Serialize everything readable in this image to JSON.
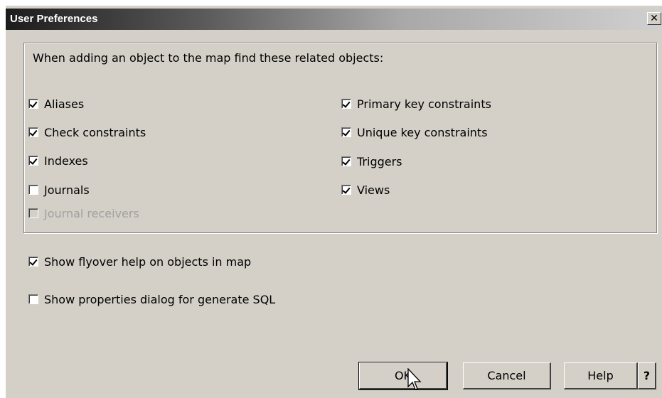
{
  "window": {
    "title": "User Preferences",
    "close_glyph": "✕"
  },
  "group": {
    "label": "When adding an object to the map find these related objects:",
    "left_items": [
      {
        "label": "Aliases",
        "checked": true,
        "enabled": true
      },
      {
        "label": "Check constraints",
        "checked": true,
        "enabled": true
      },
      {
        "label": "Indexes",
        "checked": true,
        "enabled": true
      },
      {
        "label": "Journals",
        "checked": false,
        "enabled": true
      },
      {
        "label": "Journal receivers",
        "checked": false,
        "enabled": false
      }
    ],
    "right_items": [
      {
        "label": "Primary key constraints",
        "checked": true,
        "enabled": true
      },
      {
        "label": "Unique key constraints",
        "checked": true,
        "enabled": true
      },
      {
        "label": "Triggers",
        "checked": true,
        "enabled": true
      },
      {
        "label": "Views",
        "checked": true,
        "enabled": true
      }
    ]
  },
  "options": [
    {
      "label": "Show flyover help on objects in map",
      "checked": true
    },
    {
      "label": "Show properties dialog for generate SQL",
      "checked": false
    }
  ],
  "buttons": {
    "ok": "OK",
    "cancel": "Cancel",
    "help": "Help",
    "whats_this": "?"
  }
}
